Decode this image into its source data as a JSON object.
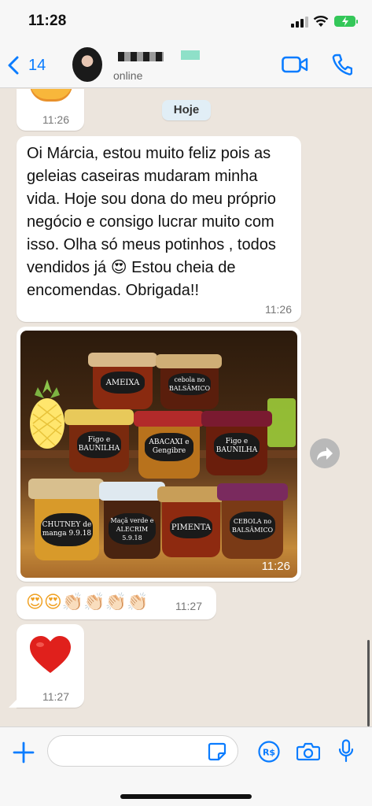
{
  "status_bar": {
    "time": "11:28"
  },
  "header": {
    "back_count": "14",
    "contact_status": "online"
  },
  "chat": {
    "top_bubble_time": "11:26",
    "date_chip": "Hoje",
    "text_message": {
      "text": "Oi Márcia, estou muito feliz pois as geleias caseiras mudaram minha vida. Hoje sou dona do meu próprio negócio e consigo lucrar muito com isso. Olha só meus potinhos , todos vendidos já 😍 Estou cheia de encomendas. Obrigada!!",
      "time": "11:26"
    },
    "photo_message": {
      "time": "11:26",
      "jar_labels": [
        "AMEIXA",
        "cebola no BALSÂMICO",
        "Figo e BAUNILHA",
        "ABACAXI e Gengibre",
        "Figo e BAUNILHA",
        "CHUTNEY de manga 9.9.18",
        "Maçã verde e ALECRIM 5.9.18",
        "PIMENTA",
        "CEBOLA no BALSÂMICO"
      ]
    },
    "emoji_message": {
      "emojis": "😍😍👏🏻👏🏻👏🏻👏🏻",
      "time": "11:27"
    },
    "heart_message": {
      "time": "11:27"
    }
  },
  "input_bar": {
    "placeholder": ""
  },
  "colors": {
    "accent_blue": "#0a7cff",
    "chat_background": "#ece5dd",
    "bubble": "#ffffff",
    "battery_green": "#34c759"
  }
}
